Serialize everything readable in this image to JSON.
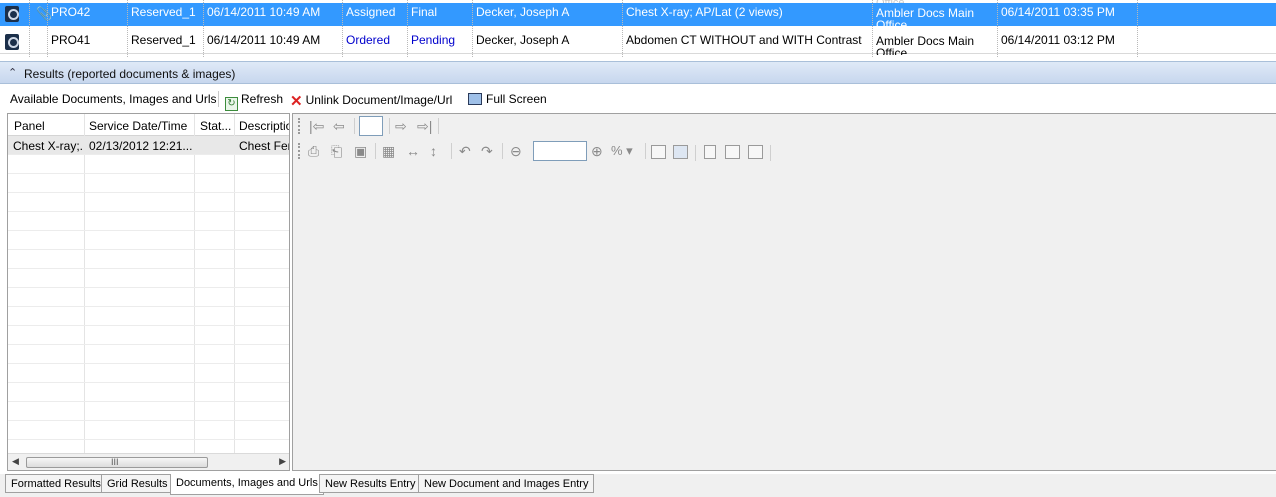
{
  "orders": {
    "rows": [
      {
        "icon": "order-icon",
        "attachment": true,
        "id": "PRO42",
        "reserved": "Reserved_1",
        "date": "06/14/2011 10:49 AM",
        "status": "Assigned",
        "result": "Final",
        "provider": "Decker, Joseph A",
        "test": "Chest X-ray; AP/Lat (2 views)",
        "location": "Ambler Docs Main Office",
        "reported": "06/14/2011 03:35 PM",
        "selected": true
      },
      {
        "icon": "order-icon",
        "attachment": false,
        "id": "PRO41",
        "reserved": "Reserved_1",
        "date": "06/14/2011 10:49 AM",
        "status": "Ordered",
        "result": "Pending",
        "provider": "Decker, Joseph A",
        "test": "Abdomen CT WITHOUT and WITH Contrast",
        "location": "Ambler Docs Main Office",
        "reported": "06/14/2011 03:12 PM",
        "selected": false
      }
    ],
    "stub_text": "Office",
    "colors": {
      "selected_bg": "#3399ff",
      "ordered": "#0000cc"
    }
  },
  "results_section": {
    "title": "Results (reported documents & images)"
  },
  "toolbar": {
    "label": "Available Documents, Images and Urls",
    "refresh": "Refresh",
    "unlink": "Unlink Document/Image/Url",
    "full_screen": "Full Screen"
  },
  "doclist": {
    "columns": [
      "Panel",
      "Service Date/Time",
      "Stat...",
      "Descriptio"
    ],
    "rows": [
      {
        "panel": "Chest X-ray;...",
        "service": "02/13/2012 12:21...",
        "status": "",
        "description": "Chest Fem"
      }
    ],
    "scroll_grip": "III"
  },
  "viewer": {
    "zoom_percent_symbol": "%"
  },
  "tabs": [
    {
      "label": "Formatted Results",
      "active": false
    },
    {
      "label": "Grid Results",
      "active": false
    },
    {
      "label": "Documents, Images and Urls",
      "active": true
    },
    {
      "label": "New Results Entry",
      "active": false
    },
    {
      "label": "New Document and Images Entry",
      "active": false
    }
  ]
}
